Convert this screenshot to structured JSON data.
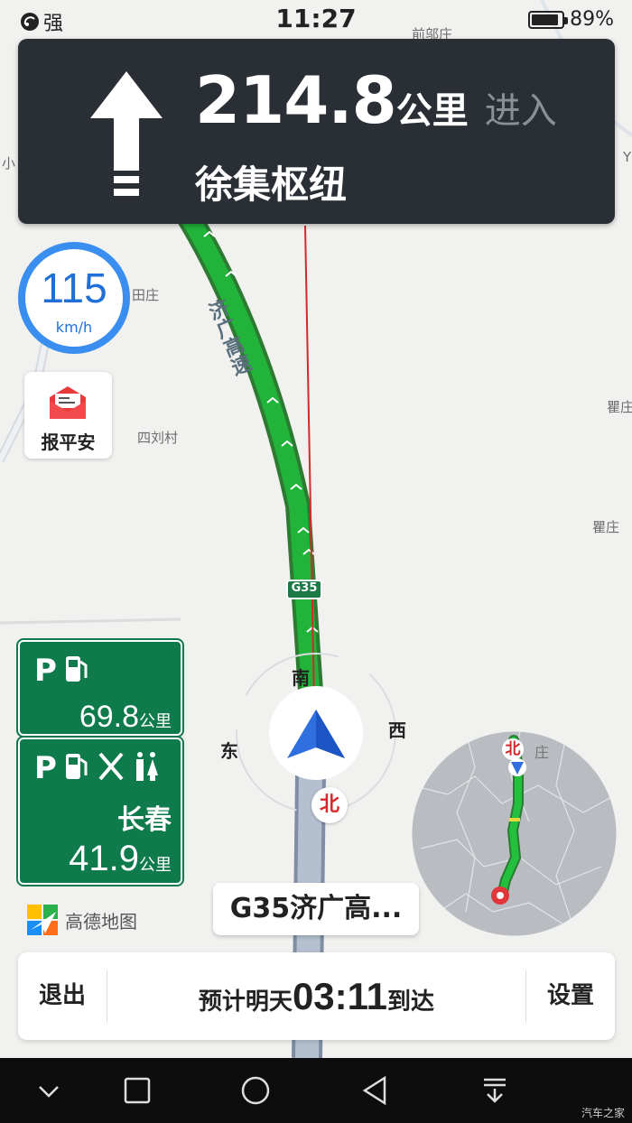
{
  "status_bar": {
    "signal_label": "强",
    "time": "11:27",
    "battery_percent": "89%",
    "battery_level": 0.89
  },
  "guidance": {
    "distance": "214.8",
    "distance_unit": "公里",
    "action": "进入",
    "next_road": "徐集枢纽",
    "maneuver_icon": "straight-arrow-icon"
  },
  "speed": {
    "value": "115",
    "unit": "km/h"
  },
  "report_safe": {
    "label": "报平安",
    "icon": "envelope-icon"
  },
  "map": {
    "places": [
      "前邬庄",
      "田庄",
      "四刘村",
      "瞿庄",
      "瞿庄",
      "小",
      "Y"
    ],
    "road_name": "济广高速",
    "road_shield": "G35",
    "compass": {
      "south": "南",
      "east": "东",
      "west": "西",
      "north": "北"
    }
  },
  "service_areas": [
    {
      "icons": [
        "parking-icon",
        "fuel-icon"
      ],
      "distance": "69.8",
      "unit": "公里"
    },
    {
      "icons": [
        "parking-icon",
        "fuel-icon",
        "restaurant-icon",
        "restroom-icon"
      ],
      "name": "长春",
      "distance": "41.9",
      "unit": "公里"
    }
  ],
  "logo_text": "高德地图",
  "current_road": "G35济广高...",
  "overview": {
    "north": "北",
    "area_label": "庄"
  },
  "bottom_bar": {
    "exit_label": "退出",
    "eta_prefix": "预计明天",
    "eta_time": "03:11",
    "eta_suffix": "到达",
    "settings_label": "设置"
  },
  "nav_buttons": [
    "chevron-down-icon",
    "square-icon",
    "circle-icon",
    "triangle-back-icon",
    "download-icon"
  ],
  "watermark": "汽车之家",
  "colors": {
    "panel": "#2a2f36",
    "route_green": "#1fa83a",
    "speed_blue": "#3a8ef0",
    "sign_green": "#0f7a4b"
  }
}
